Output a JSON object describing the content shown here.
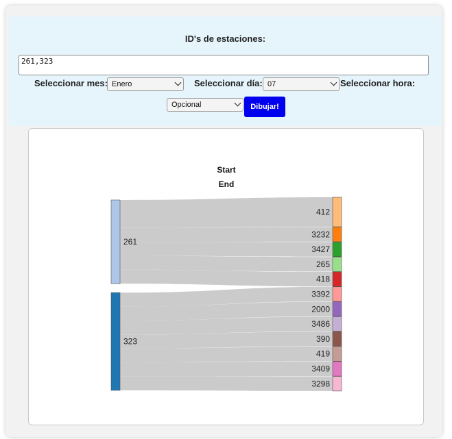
{
  "form": {
    "ids_label": "ID's de estaciones:",
    "ids_value": "261,323",
    "month_label": "Seleccionar mes:",
    "month_value": "Enero",
    "day_label": "Seleccionar día:",
    "day_value": "07",
    "hour_label": "Seleccionar hora:",
    "hour_value": "Opcional",
    "submit_label": "Dibujar!",
    "submit_color": "#0000ee"
  },
  "chart_data": {
    "type": "sankey",
    "headers": [
      "Start",
      "End"
    ],
    "sources": [
      {
        "label": "261",
        "color": "#aec7e8",
        "targets": [
          "412",
          "3232",
          "3427",
          "265",
          "418"
        ]
      },
      {
        "label": "323",
        "color": "#1f77b4",
        "targets": [
          "3392",
          "2000",
          "3486",
          "390",
          "419",
          "3409",
          "3298"
        ]
      }
    ],
    "targets": [
      {
        "label": "412",
        "color": "#ffbb78",
        "weight": 2
      },
      {
        "label": "3232",
        "color": "#ff7f0e",
        "weight": 1
      },
      {
        "label": "3427",
        "color": "#2ca02c",
        "weight": 1
      },
      {
        "label": "265",
        "color": "#98df8a",
        "weight": 1
      },
      {
        "label": "418",
        "color": "#d62728",
        "weight": 1
      },
      {
        "label": "3392",
        "color": "#ff9896",
        "weight": 1
      },
      {
        "label": "2000",
        "color": "#9467bd",
        "weight": 1
      },
      {
        "label": "3486",
        "color": "#c5b0d5",
        "weight": 1
      },
      {
        "label": "390",
        "color": "#8c564b",
        "weight": 1
      },
      {
        "label": "419",
        "color": "#c49c94",
        "weight": 1
      },
      {
        "label": "3409",
        "color": "#e377c2",
        "weight": 1
      },
      {
        "label": "3298",
        "color": "#f7b6d2",
        "weight": 1
      }
    ],
    "link_color": "#c8c8c8"
  }
}
